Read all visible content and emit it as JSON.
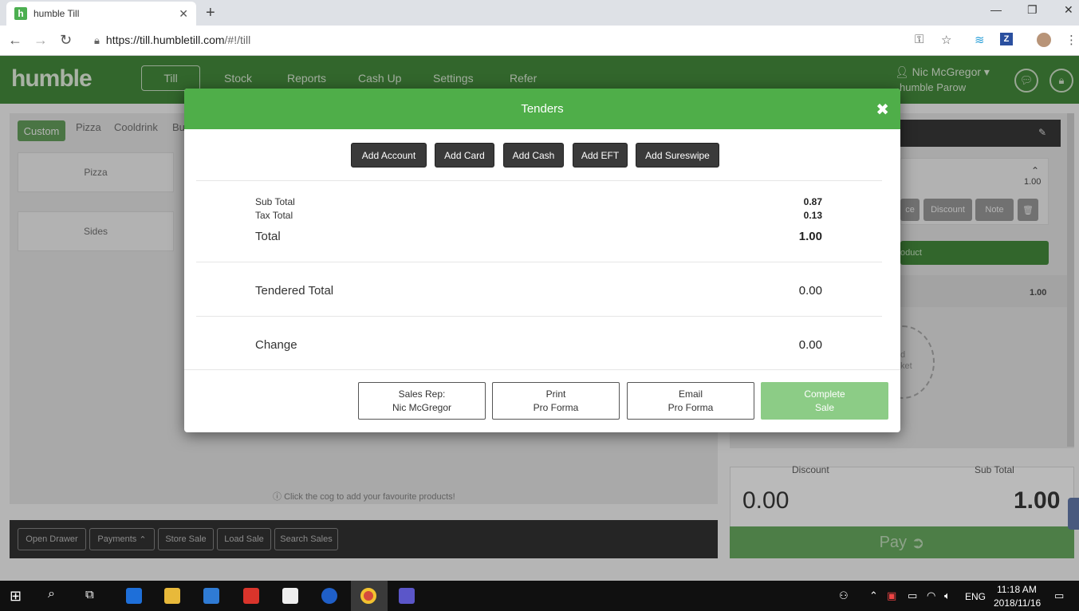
{
  "browser": {
    "tab_title": "humble Till",
    "favicon_letter": "h",
    "url_host": "https://till.humbletill.com",
    "url_path": "/#!/till"
  },
  "app": {
    "logo": "humble",
    "nav": [
      "Till",
      "Stock",
      "Reports",
      "Cash Up",
      "Settings",
      "Refer"
    ],
    "user_name": "Nic McGregor",
    "store_name": "humble Parow",
    "accent_color": "#3d7d36"
  },
  "categories": [
    "Custom",
    "Pizza",
    "Cooldrink",
    "Bu"
  ],
  "category_tiles": [
    "Pizza",
    "Sides"
  ],
  "hint": "Click the cog to add your favourite products!",
  "bottom_buttons": [
    "Open Drawer",
    "Payments",
    "Store Sale",
    "Load Sale",
    "Search Sales"
  ],
  "basket": {
    "item_qty": "1.00",
    "btn_price_fragment": "ce",
    "btn_discount": "Discount",
    "btn_note": "Note",
    "add_product_fragment": "oduct",
    "line_total": "1.00",
    "empty_fragment_1": "d",
    "empty_fragment_2": "ket",
    "discount_label": "Discount",
    "subtotal_label": "Sub Total",
    "discount_value": "0.00",
    "subtotal_value": "1.00",
    "pay_label": "Pay"
  },
  "modal": {
    "title": "Tenders",
    "add_buttons": [
      "Add Account",
      "Add Card",
      "Add Cash",
      "Add EFT",
      "Add Sureswipe"
    ],
    "sub_total_label": "Sub Total",
    "sub_total_value": "0.87",
    "tax_total_label": "Tax Total",
    "tax_total_value": "0.13",
    "total_label": "Total",
    "total_value": "1.00",
    "tendered_label": "Tendered Total",
    "tendered_value": "0.00",
    "change_label": "Change",
    "change_value": "0.00",
    "footer": {
      "sales_rep_line1": "Sales Rep:",
      "sales_rep_line2": "Nic McGregor",
      "print_line1": "Print",
      "print_line2": "Pro Forma",
      "email_line1": "Email",
      "email_line2": "Pro Forma",
      "complete_line1": "Complete",
      "complete_line2": "Sale"
    },
    "complete_color": "#8ccc86"
  },
  "taskbar": {
    "time": "11:18 AM",
    "date": "2018/11/16",
    "lang": "ENG"
  }
}
